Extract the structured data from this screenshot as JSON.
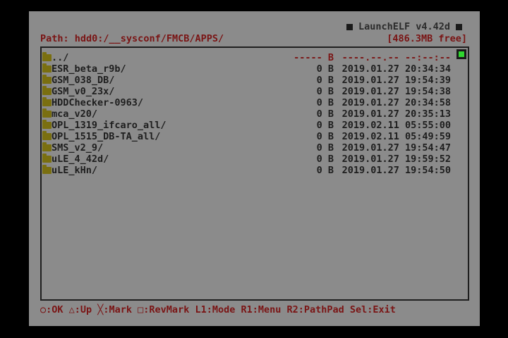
{
  "app": {
    "title": "LaunchELF v4.42d"
  },
  "path": {
    "label": "Path:",
    "value": "hdd0:/__sysconf/FMCB/APPS/",
    "free_space": "[486.3MB free]"
  },
  "files": [
    {
      "name": "../",
      "size": "----- B",
      "date": "----.--.-- --:--:--"
    },
    {
      "name": "ESR_beta_r9b/",
      "size": "0 B",
      "date": "2019.01.27 20:34:34"
    },
    {
      "name": "GSM_038_DB/",
      "size": "0 B",
      "date": "2019.01.27 19:54:39"
    },
    {
      "name": "GSM_v0_23x/",
      "size": "0 B",
      "date": "2019.01.27 19:54:38"
    },
    {
      "name": "HDDChecker-0963/",
      "size": "0 B",
      "date": "2019.01.27 20:34:58"
    },
    {
      "name": "mca_v20/",
      "size": "0 B",
      "date": "2019.01.27 20:35:13"
    },
    {
      "name": "OPL_1319_ifcaro_all/",
      "size": "0 B",
      "date": "2019.02.11 05:55:00"
    },
    {
      "name": "OPL_1515_DB-TA_all/",
      "size": "0 B",
      "date": "2019.02.11 05:49:59"
    },
    {
      "name": "SMS_v2_9/",
      "size": "0 B",
      "date": "2019.01.27 19:54:47"
    },
    {
      "name": "uLE_4_42d/",
      "size": "0 B",
      "date": "2019.01.27 19:59:52"
    },
    {
      "name": "uLE_kHn/",
      "size": "0 B",
      "date": "2019.01.27 19:54:50"
    }
  ],
  "help": {
    "text": "○:OK △:Up ╳:Mark □:RevMark L1:Mode R1:Menu R2:PathPad Sel:Exit"
  },
  "colors": {
    "background": "#8b8b8b",
    "text_red": "#7a1414",
    "text_dark": "#1e1e1e",
    "folder": "#7a6f10",
    "scroll_indicator": "#2fd62f"
  }
}
